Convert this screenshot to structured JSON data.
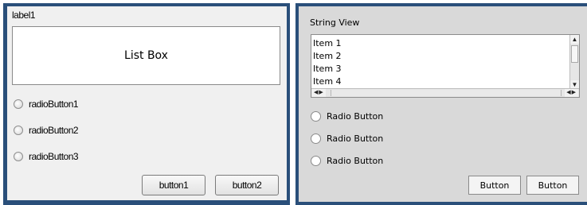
{
  "left": {
    "label": "label1",
    "listbox_text": "List Box",
    "radios": [
      "radioButton1",
      "radioButton2",
      "radioButton3"
    ],
    "buttons": [
      "button1",
      "button2"
    ]
  },
  "right": {
    "title": "String View",
    "items": [
      "Item 1",
      "Item 2",
      "Item 3",
      "Item 4"
    ],
    "radios": [
      "Radio Button",
      "Radio Button",
      "Radio Button"
    ],
    "buttons": [
      "Button",
      "Button"
    ],
    "icons": {
      "scroll_up": "▲",
      "scroll_down": "▼",
      "scroll_left": "◀",
      "scroll_right": "▶"
    }
  },
  "colors": {
    "window_frame": "#2a4f7a",
    "left_background": "#f0f0f0",
    "right_background": "#d9d9d9"
  }
}
